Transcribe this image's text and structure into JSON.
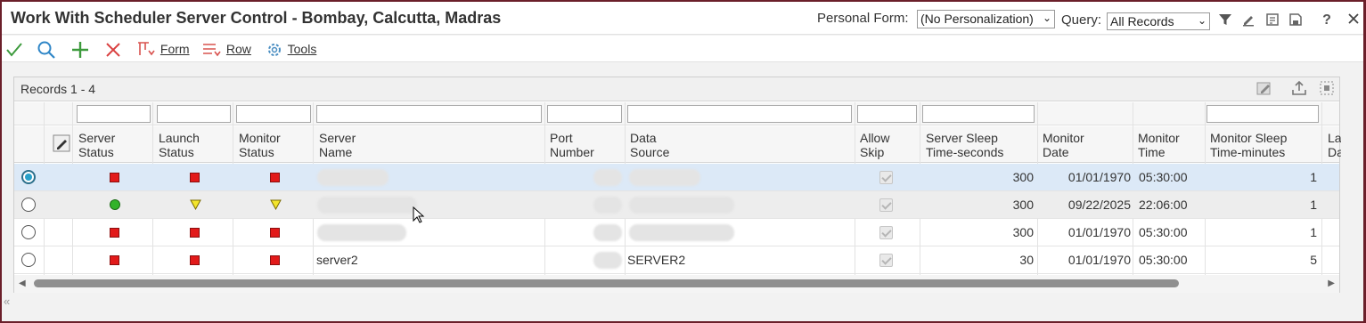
{
  "window": {
    "title": "Work With Scheduler Server Control - Bombay, Calcutta, Madras",
    "personal_form_label": "Personal Form:",
    "personal_form_value": "(No Personalization)",
    "query_label": "Query:",
    "query_value": "All Records"
  },
  "toolbar": {
    "form_label": "Form",
    "row_label": "Row",
    "tools_label": "Tools"
  },
  "grid": {
    "records_label": "Records 1 - 4",
    "columns": {
      "server_status": "Server Status",
      "launch_status": "Launch Status",
      "monitor_status": "Monitor Status",
      "server_name": "Server Name",
      "port_number": "Port Number",
      "data_source": "Data Source",
      "allow_skip": "Allow Skip",
      "server_sleep": "Server Sleep Time-seconds",
      "monitor_date": "Monitor Date",
      "monitor_time": "Monitor Time",
      "monitor_sleep": "Monitor Sleep Time-minutes",
      "last_date": "La Da"
    },
    "rows": [
      {
        "selected": true,
        "server_status": "red-square",
        "launch_status": "red-square",
        "monitor_status": "red-square",
        "server_name": "",
        "port_number": "",
        "data_source": "",
        "server_sleep": "300",
        "monitor_date": "01/01/1970",
        "monitor_time": "05:30:00",
        "monitor_sleep": "1"
      },
      {
        "selected": false,
        "server_status": "green-circle",
        "launch_status": "yellow-triangle",
        "monitor_status": "yellow-triangle",
        "server_name": "",
        "port_number": "",
        "data_source": "",
        "server_sleep": "300",
        "monitor_date": "09/22/2025",
        "monitor_time": "22:06:00",
        "monitor_sleep": "1"
      },
      {
        "selected": false,
        "server_status": "red-square",
        "launch_status": "red-square",
        "monitor_status": "red-square",
        "server_name": "",
        "port_number": "",
        "data_source": "",
        "server_sleep": "300",
        "monitor_date": "01/01/1970",
        "monitor_time": "05:30:00",
        "monitor_sleep": "1"
      },
      {
        "selected": false,
        "server_status": "red-square",
        "launch_status": "red-square",
        "monitor_status": "red-square",
        "server_name": "server2",
        "port_number": "",
        "data_source": "SERVER2",
        "server_sleep": "30",
        "monitor_date": "01/01/1970",
        "monitor_time": "05:30:00",
        "monitor_sleep": "5"
      }
    ]
  },
  "colors": {
    "status_red": "#e21a1a",
    "status_green": "#32b32a",
    "status_yellow": "#f3e52b",
    "selected_row": "#dce9f7"
  }
}
